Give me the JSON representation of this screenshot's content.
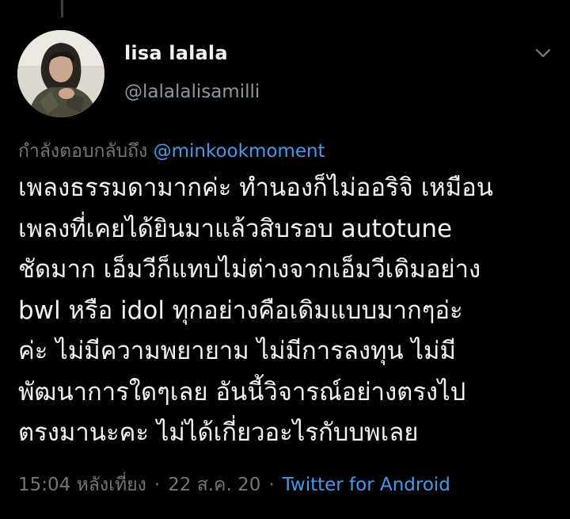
{
  "tweet": {
    "author": {
      "display_name": "lisa lalala",
      "handle": "@lalalalisamilli"
    },
    "reply_prefix": "กำลังตอบกลับถึง",
    "reply_to": "@minkookmoment",
    "text_lines": [
      "เพลงธรรมดามากค่ะ ทำนองก็ไม่ออริจิ เหมือน",
      "เพลงที่เคยได้ยินมาแล้วสิบรอบ autotune",
      "ชัดมาก เอ็มวีก็แทบไม่ต่างจากเอ็มวีเดิมอย่าง",
      "bwl หรือ idol ทุกอย่างคือเดิมแบบมากๆอ่ะ",
      "ค่ะ ไม่มีความพยายาม ไม่มีการลงทุน ไม่มี",
      "พัฒนาการใดๆเลย อันนี้วิจารณ์อย่างตรงไป",
      "ตรงมานะคะ ไม่ได้เกี่ยวอะไรกับบพเลย"
    ],
    "time": "15:04 หลังเที่ยง",
    "separator": "·",
    "date": "22 ส.ค. 20",
    "source": "Twitter for Android"
  },
  "icons": {
    "more": "chevron-down-icon",
    "avatar": "avatar"
  },
  "colors": {
    "background": "#000000",
    "text": "#f2f2f2",
    "secondary": "#71767b",
    "link": "#4a99e9"
  }
}
